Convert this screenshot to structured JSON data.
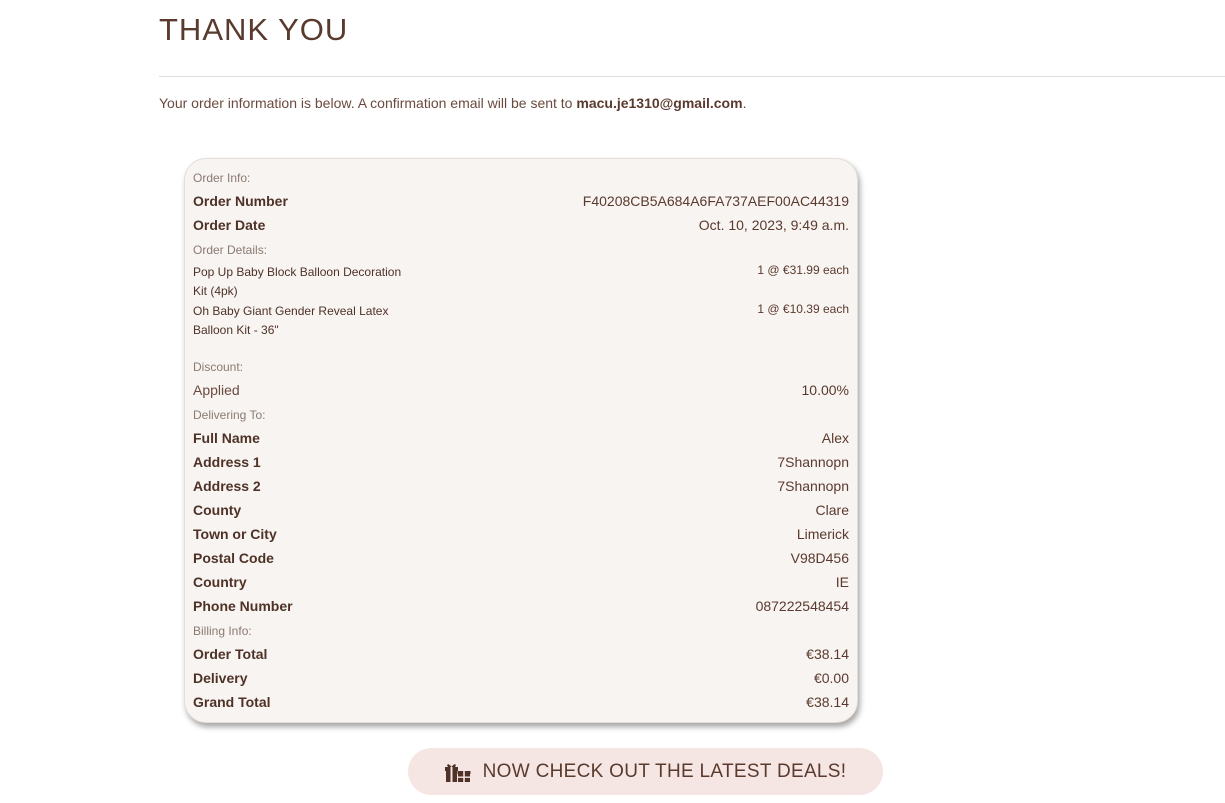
{
  "page": {
    "title": "THANK YOU",
    "intro_text": "Your order information is below. A confirmation email will be sent to ",
    "email": "macu.je1310@gmail.com",
    "intro_end": "."
  },
  "order_info": {
    "section_label": "Order Info:",
    "number_label": "Order Number",
    "number_value": "F40208CB5A684A6FA737AEF00AC44319",
    "date_label": "Order Date",
    "date_value": "Oct. 10, 2023, 9:49 a.m."
  },
  "order_details": {
    "section_label": "Order Details:",
    "items": [
      {
        "name": "Pop Up Baby Block Balloon Decoration Kit (4pk)",
        "qty": "1 @ €31.99 each"
      },
      {
        "name": "Oh Baby Giant Gender Reveal Latex Balloon Kit - 36\"",
        "qty": "1 @ €10.39 each"
      }
    ]
  },
  "discount": {
    "section_label": "Discount:",
    "label": "Applied",
    "value": "10.00%"
  },
  "delivering": {
    "section_label": "Delivering To:",
    "rows": [
      {
        "label": "Full Name",
        "value": "Alex"
      },
      {
        "label": "Address 1",
        "value": "7Shannopn"
      },
      {
        "label": "Address 2",
        "value": "7Shannopn"
      },
      {
        "label": "County",
        "value": "Clare"
      },
      {
        "label": "Town or City",
        "value": "Limerick"
      },
      {
        "label": "Postal Code",
        "value": "V98D456"
      },
      {
        "label": "Country",
        "value": "IE"
      },
      {
        "label": "Phone Number",
        "value": "087222548454"
      }
    ]
  },
  "billing": {
    "section_label": "Billing Info:",
    "rows": [
      {
        "label": "Order Total",
        "value": "€38.14"
      },
      {
        "label": "Delivery",
        "value": "€0.00"
      },
      {
        "label": "Grand Total",
        "value": "€38.14"
      }
    ]
  },
  "cta": {
    "label": "NOW CHECK OUT THE LATEST DEALS!",
    "icon": "gifts-icon"
  },
  "colors": {
    "text": "#5a3a2e",
    "card_bg": "#f8f4f1",
    "button_bg": "#f5e6e4"
  }
}
